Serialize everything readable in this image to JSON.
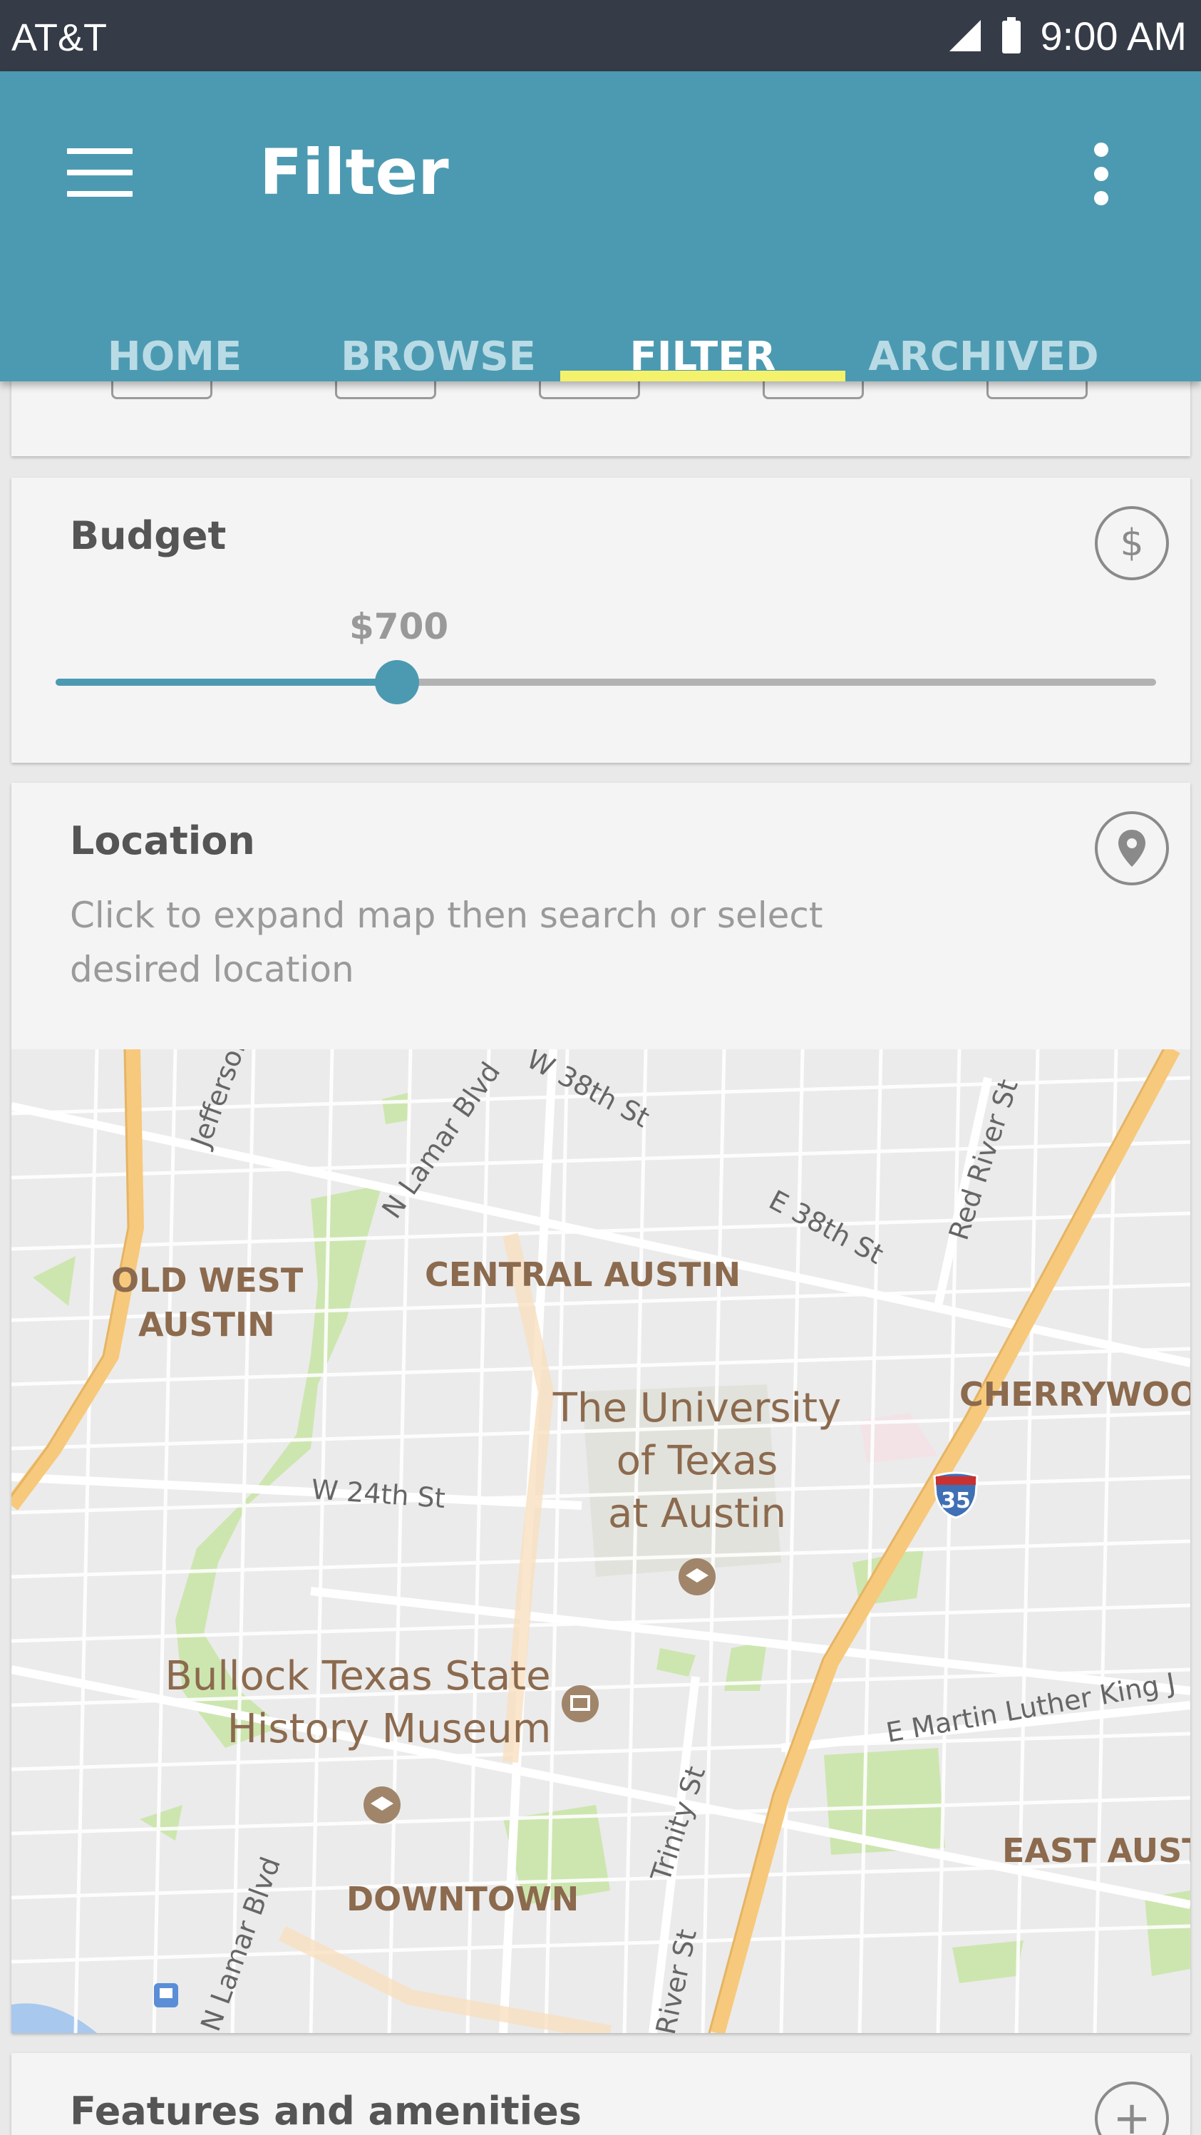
{
  "status_bar": {
    "carrier": "AT&T",
    "time": "9:00 AM"
  },
  "app_bar": {
    "title": "Filter",
    "tabs": [
      {
        "label": "HOME",
        "active": false
      },
      {
        "label": "BROWSE",
        "active": false
      },
      {
        "label": "FILTER",
        "active": true
      },
      {
        "label": "ARCHIVED",
        "active": false
      }
    ]
  },
  "budget": {
    "title": "Budget",
    "value_label": "$700",
    "icon_symbol": "$",
    "slider_fraction": 0.31
  },
  "location": {
    "title": "Location",
    "description": "Click to expand map then search or select desired location",
    "map_labels": {
      "old_west_austin_1": "OLD WEST",
      "old_west_austin_2": "AUSTIN",
      "central_austin": "CENTRAL AUSTIN",
      "university_1": "The University",
      "university_2": "of Texas",
      "university_3": "at Austin",
      "cherrywood": "CHERRYWOO",
      "bullock_1": "Bullock Texas State",
      "bullock_2": "History Museum",
      "downtown": "DOWNTOWN",
      "east_austin": "EAST AUST",
      "jefferson": "Jefferson",
      "n_lamar_blvd": "N Lamar Blvd",
      "w_38th_st": "W 38th St",
      "e_38th_st": "E 38th St",
      "red_river_st": "Red River St",
      "w_24th_st": "W 24th St",
      "mlk": "E Martin Luther King J",
      "trinity_st": "Trinity St",
      "n_lamar_blvd_2": "N Lamar Blvd",
      "river_st": "River St",
      "i35": "35"
    }
  },
  "features": {
    "title": "Features and amenities",
    "icon_symbol": "+"
  },
  "colors": {
    "status_bar": "#353c48",
    "primary": "#4c9ab2",
    "tab_indicator": "#f4f26b",
    "card_bg": "#f4f4f4",
    "highway": "#f7c97c",
    "park": "#cde6b0",
    "map_label": "#8b6a4e"
  }
}
